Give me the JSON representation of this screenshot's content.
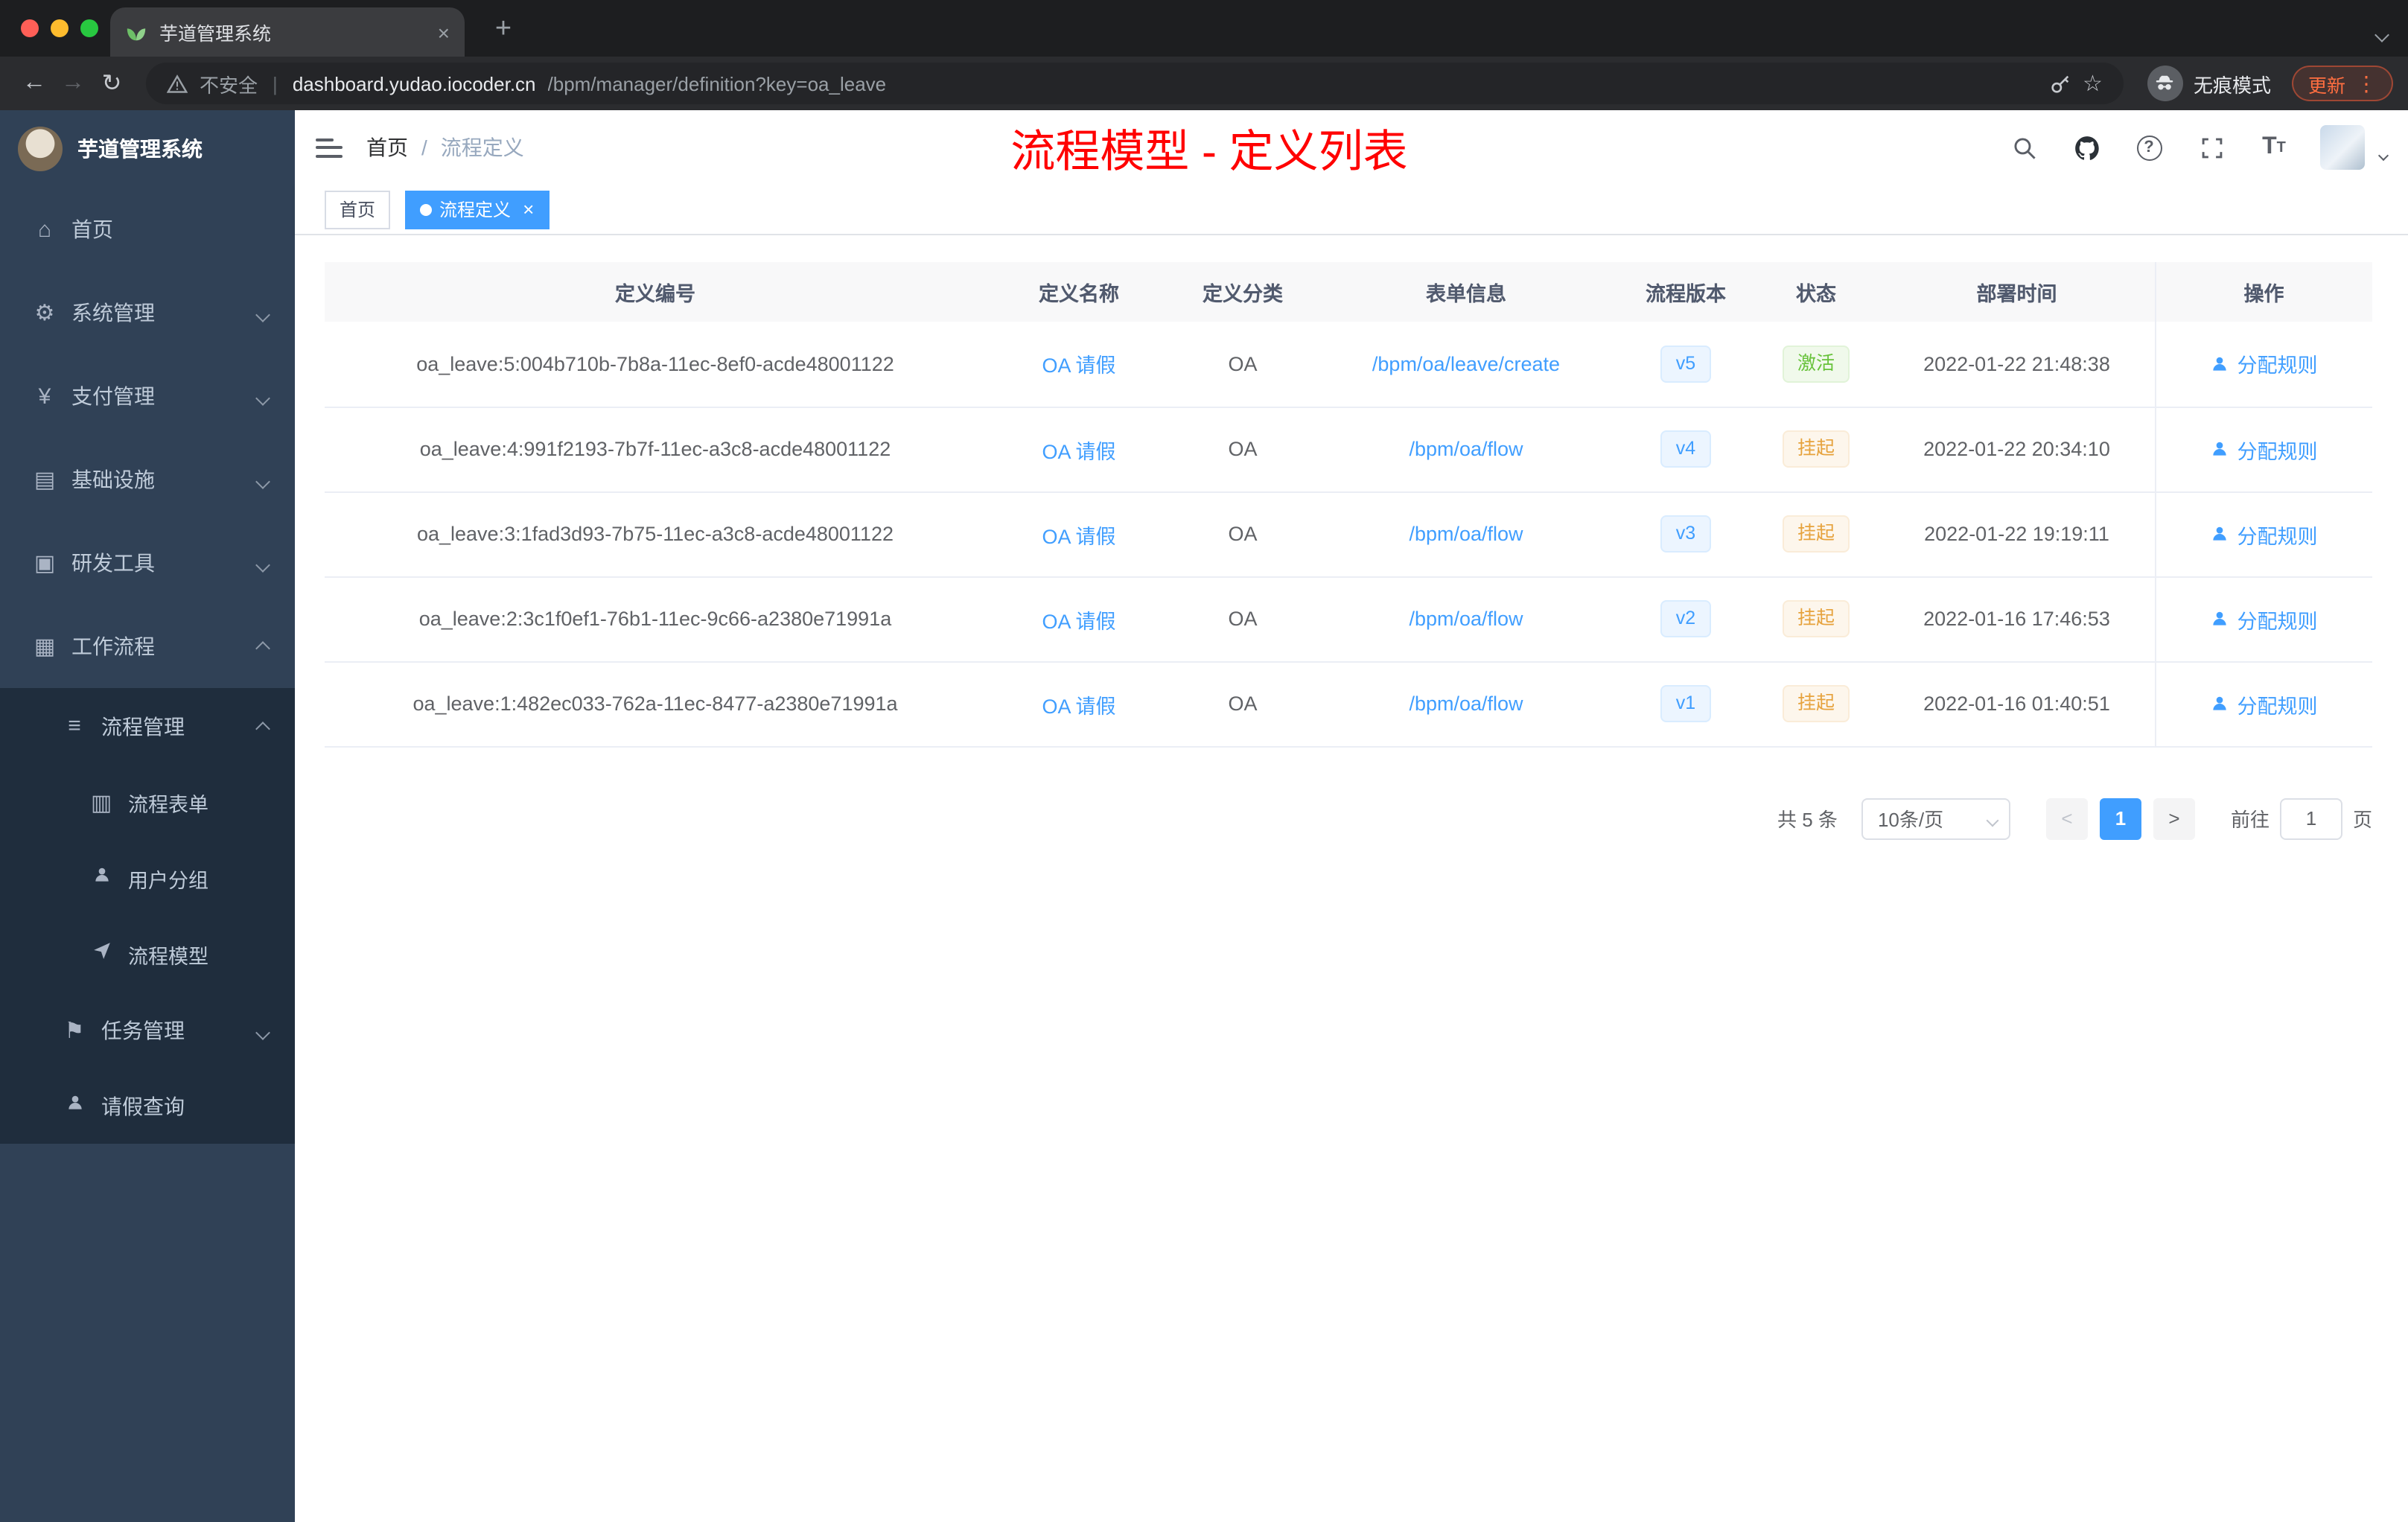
{
  "browser": {
    "tab_title": "芋道管理系统",
    "security_label": "不安全",
    "url_domain": "dashboard.yudao.iocoder.cn",
    "url_path": "/bpm/manager/definition?key=oa_leave",
    "incognito_label": "无痕模式",
    "update_label": "更新"
  },
  "sidebar": {
    "logo_title": "芋道管理系统",
    "items": [
      {
        "label": "首页",
        "icon": "home-icon"
      },
      {
        "label": "系统管理",
        "icon": "gear-icon"
      },
      {
        "label": "支付管理",
        "icon": "yen-icon"
      },
      {
        "label": "基础设施",
        "icon": "infra-icon"
      },
      {
        "label": "研发工具",
        "icon": "tools-icon"
      },
      {
        "label": "工作流程",
        "icon": "workflow-icon"
      },
      {
        "label": "流程管理",
        "icon": "list-icon"
      },
      {
        "label": "流程表单",
        "icon": "form-icon"
      },
      {
        "label": "用户分组",
        "icon": "users-icon"
      },
      {
        "label": "流程模型",
        "icon": "send-icon"
      },
      {
        "label": "任务管理",
        "icon": "task-icon"
      },
      {
        "label": "请假查询",
        "icon": "person-icon"
      }
    ]
  },
  "header": {
    "breadcrumb_home": "首页",
    "breadcrumb_sep": "/",
    "breadcrumb_current": "流程定义",
    "page_title": "流程模型 - 定义列表"
  },
  "tags": {
    "home": "首页",
    "active": "流程定义"
  },
  "table": {
    "columns": [
      "定义编号",
      "定义名称",
      "定义分类",
      "表单信息",
      "流程版本",
      "状态",
      "部署时间",
      "操作"
    ],
    "action_label": "分配规则",
    "rows": [
      {
        "id": "oa_leave:5:004b710b-7b8a-11ec-8ef0-acde48001122",
        "name": "OA 请假",
        "category": "OA",
        "form": "/bpm/oa/leave/create",
        "version": "v5",
        "status": "激活",
        "time": "2022-01-22 21:48:38"
      },
      {
        "id": "oa_leave:4:991f2193-7b7f-11ec-a3c8-acde48001122",
        "name": "OA 请假",
        "category": "OA",
        "form": "/bpm/oa/flow",
        "version": "v4",
        "status": "挂起",
        "time": "2022-01-22 20:34:10"
      },
      {
        "id": "oa_leave:3:1fad3d93-7b75-11ec-a3c8-acde48001122",
        "name": "OA 请假",
        "category": "OA",
        "form": "/bpm/oa/flow",
        "version": "v3",
        "status": "挂起",
        "time": "2022-01-22 19:19:11"
      },
      {
        "id": "oa_leave:2:3c1f0ef1-76b1-11ec-9c66-a2380e71991a",
        "name": "OA 请假",
        "category": "OA",
        "form": "/bpm/oa/flow",
        "version": "v2",
        "status": "挂起",
        "time": "2022-01-16 17:46:53"
      },
      {
        "id": "oa_leave:1:482ec033-762a-11ec-8477-a2380e71991a",
        "name": "OA 请假",
        "category": "OA",
        "form": "/bpm/oa/flow",
        "version": "v1",
        "status": "挂起",
        "time": "2022-01-16 01:40:51"
      }
    ]
  },
  "pagination": {
    "total": "共 5 条",
    "page_size": "10条/页",
    "current_page": "1",
    "goto_label": "前往",
    "goto_value": "1",
    "page_unit": "页"
  },
  "colors": {
    "accent": "#409eff",
    "success": "#67c23a",
    "warning": "#e6a23c",
    "title_red": "#ff0000",
    "sidebar_bg": "#304156",
    "sidebar_sub_bg": "#1f2d3d"
  }
}
